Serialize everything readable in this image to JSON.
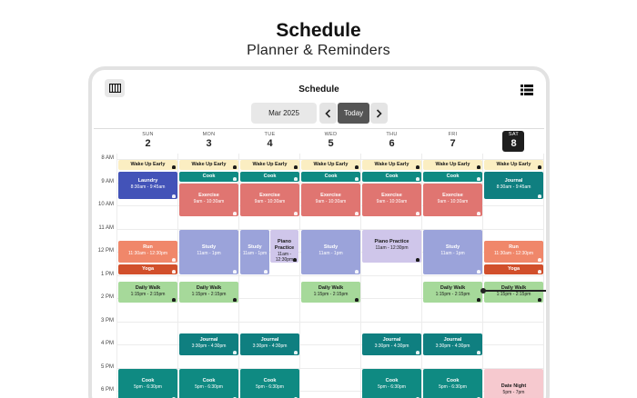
{
  "hero": {
    "title": "Schedule",
    "subtitle": "Planner & Reminders"
  },
  "app": {
    "title": "Schedule",
    "month": "Mar 2025",
    "today_label": "Today",
    "icons": {
      "view_toggle": "week-view-icon",
      "list": "list-icon",
      "prev": "chevron-left-icon",
      "next": "chevron-right-icon",
      "reminder": "bell-icon"
    }
  },
  "days": [
    {
      "dow": "SUN",
      "num": "2",
      "today": false
    },
    {
      "dow": "MON",
      "num": "3",
      "today": false
    },
    {
      "dow": "TUE",
      "num": "4",
      "today": false
    },
    {
      "dow": "WED",
      "num": "5",
      "today": false
    },
    {
      "dow": "THU",
      "num": "6",
      "today": false
    },
    {
      "dow": "FRI",
      "num": "7",
      "today": false
    },
    {
      "dow": "SAT",
      "num": "8",
      "today": true
    }
  ],
  "hours": [
    "8 AM",
    "9 AM",
    "10 AM",
    "11 AM",
    "12 PM",
    "1 PM",
    "2 PM",
    "3 PM",
    "4 PM",
    "5 PM",
    "6 PM"
  ],
  "events": [
    {
      "day": 0,
      "title": "Wake Up Early",
      "time": "",
      "color": "wake",
      "start": 8.0,
      "end": 8.5,
      "bell": true
    },
    {
      "day": 1,
      "title": "Wake Up Early",
      "time": "",
      "color": "wake",
      "start": 8.0,
      "end": 8.5,
      "bell": true
    },
    {
      "day": 2,
      "title": "Wake Up Early",
      "time": "",
      "color": "wake",
      "start": 8.0,
      "end": 8.5,
      "bell": true
    },
    {
      "day": 3,
      "title": "Wake Up Early",
      "time": "",
      "color": "wake",
      "start": 8.0,
      "end": 8.5,
      "bell": true
    },
    {
      "day": 4,
      "title": "Wake Up Early",
      "time": "",
      "color": "wake",
      "start": 8.0,
      "end": 8.5,
      "bell": true
    },
    {
      "day": 5,
      "title": "Wake Up Early",
      "time": "",
      "color": "wake",
      "start": 8.0,
      "end": 8.5,
      "bell": true
    },
    {
      "day": 6,
      "title": "Wake Up Early",
      "time": "",
      "color": "wake",
      "start": 8.0,
      "end": 8.5,
      "bell": true
    },
    {
      "day": 0,
      "title": "Laundry",
      "time": "8:30am - 9:45am",
      "color": "laundry",
      "start": 8.5,
      "end": 9.75,
      "bell": true
    },
    {
      "day": 1,
      "title": "Cook",
      "time": "",
      "color": "cook",
      "start": 8.5,
      "end": 9.0,
      "bell": true
    },
    {
      "day": 2,
      "title": "Cook",
      "time": "",
      "color": "cook",
      "start": 8.5,
      "end": 9.0,
      "bell": true
    },
    {
      "day": 3,
      "title": "Cook",
      "time": "",
      "color": "cook",
      "start": 8.5,
      "end": 9.0,
      "bell": true
    },
    {
      "day": 4,
      "title": "Cook",
      "time": "",
      "color": "cook",
      "start": 8.5,
      "end": 9.0,
      "bell": true
    },
    {
      "day": 5,
      "title": "Cook",
      "time": "",
      "color": "cook",
      "start": 8.5,
      "end": 9.0,
      "bell": true
    },
    {
      "day": 6,
      "title": "Journal",
      "time": "8:30am - 9:45am",
      "color": "journal",
      "start": 8.5,
      "end": 9.75,
      "bell": true
    },
    {
      "day": 1,
      "title": "Exercise",
      "time": "9am - 10:30am",
      "color": "exercise",
      "start": 9.0,
      "end": 10.5,
      "bell": true
    },
    {
      "day": 2,
      "title": "Exercise",
      "time": "9am - 10:30am",
      "color": "exercise",
      "start": 9.0,
      "end": 10.5,
      "bell": true
    },
    {
      "day": 3,
      "title": "Exercise",
      "time": "9am - 10:30am",
      "color": "exercise",
      "start": 9.0,
      "end": 10.5,
      "bell": true
    },
    {
      "day": 4,
      "title": "Exercise",
      "time": "9am - 10:30am",
      "color": "exercise",
      "start": 9.0,
      "end": 10.5,
      "bell": true
    },
    {
      "day": 5,
      "title": "Exercise",
      "time": "9am - 10:30am",
      "color": "exercise",
      "start": 9.0,
      "end": 10.5,
      "bell": true
    },
    {
      "day": 0,
      "title": "Run",
      "time": "11:30am - 12:30pm",
      "color": "run",
      "start": 11.5,
      "end": 12.5,
      "bell": true
    },
    {
      "day": 0,
      "title": "Yoga",
      "time": "",
      "color": "yoga",
      "start": 12.5,
      "end": 13.0,
      "bell": true
    },
    {
      "day": 6,
      "title": "Run",
      "time": "11:30am - 12:30pm",
      "color": "run",
      "start": 11.5,
      "end": 12.5,
      "bell": true
    },
    {
      "day": 6,
      "title": "Yoga",
      "time": "",
      "color": "yoga",
      "start": 12.5,
      "end": 13.0,
      "bell": true
    },
    {
      "day": 1,
      "title": "Study",
      "time": "11am - 1pm",
      "color": "study",
      "start": 11.0,
      "end": 13.0,
      "bell": true
    },
    {
      "day": 2,
      "title": "Study",
      "time": "11am - 1pm",
      "color": "study",
      "start": 11.0,
      "end": 13.0,
      "bell": true,
      "half": "left"
    },
    {
      "day": 2,
      "title": "Piano Practice",
      "time": "11am - 12:30pm",
      "color": "piano",
      "start": 11.0,
      "end": 12.5,
      "bell": true,
      "half": "right"
    },
    {
      "day": 3,
      "title": "Study",
      "time": "11am - 1pm",
      "color": "study",
      "start": 11.0,
      "end": 13.0,
      "bell": true
    },
    {
      "day": 4,
      "title": "Piano Practice",
      "time": "11am - 12:30pm",
      "color": "piano",
      "start": 11.0,
      "end": 12.5,
      "bell": true
    },
    {
      "day": 5,
      "title": "Study",
      "time": "11am - 1pm",
      "color": "study",
      "start": 11.0,
      "end": 13.0,
      "bell": true
    },
    {
      "day": 0,
      "title": "Daily Walk",
      "time": "1:15pm - 2:15pm",
      "color": "walk",
      "start": 13.25,
      "end": 14.25,
      "bell": true
    },
    {
      "day": 1,
      "title": "Daily Walk",
      "time": "1:15pm - 2:15pm",
      "color": "walk",
      "start": 13.25,
      "end": 14.25,
      "bell": true
    },
    {
      "day": 3,
      "title": "Daily Walk",
      "time": "1:15pm - 2:15pm",
      "color": "walk",
      "start": 13.25,
      "end": 14.25,
      "bell": true
    },
    {
      "day": 5,
      "title": "Daily Walk",
      "time": "1:15pm - 2:15pm",
      "color": "walk",
      "start": 13.25,
      "end": 14.25,
      "bell": true
    },
    {
      "day": 6,
      "title": "Daily Walk",
      "time": "1:15pm - 2:15pm",
      "color": "walk",
      "start": 13.25,
      "end": 14.25,
      "bell": true
    },
    {
      "day": 1,
      "title": "Journal",
      "time": "3:30pm - 4:30pm",
      "color": "journal",
      "start": 15.5,
      "end": 16.5,
      "bell": true
    },
    {
      "day": 2,
      "title": "Journal",
      "time": "3:30pm - 4:30pm",
      "color": "journal",
      "start": 15.5,
      "end": 16.5,
      "bell": true
    },
    {
      "day": 4,
      "title": "Journal",
      "time": "3:30pm - 4:30pm",
      "color": "journal",
      "start": 15.5,
      "end": 16.5,
      "bell": true
    },
    {
      "day": 5,
      "title": "Journal",
      "time": "3:30pm - 4:30pm",
      "color": "journal",
      "start": 15.5,
      "end": 16.5,
      "bell": true
    },
    {
      "day": 0,
      "title": "Cook",
      "time": "5pm - 6:30pm",
      "color": "cook",
      "start": 17.0,
      "end": 18.5,
      "bell": true
    },
    {
      "day": 1,
      "title": "Cook",
      "time": "5pm - 6:30pm",
      "color": "cook",
      "start": 17.0,
      "end": 18.5,
      "bell": true
    },
    {
      "day": 2,
      "title": "Cook",
      "time": "5pm - 6:30pm",
      "color": "cook",
      "start": 17.0,
      "end": 18.5,
      "bell": true
    },
    {
      "day": 4,
      "title": "Cook",
      "time": "5pm - 6:30pm",
      "color": "cook",
      "start": 17.0,
      "end": 18.5,
      "bell": true
    },
    {
      "day": 5,
      "title": "Cook",
      "time": "5pm - 6:30pm",
      "color": "cook",
      "start": 17.0,
      "end": 18.5,
      "bell": true
    },
    {
      "day": 6,
      "title": "Date Night",
      "time": "5pm - 7pm",
      "color": "date",
      "start": 17.0,
      "end": 19.0,
      "bell": false
    }
  ],
  "current_time": {
    "day": 6,
    "hour": 13.7
  }
}
